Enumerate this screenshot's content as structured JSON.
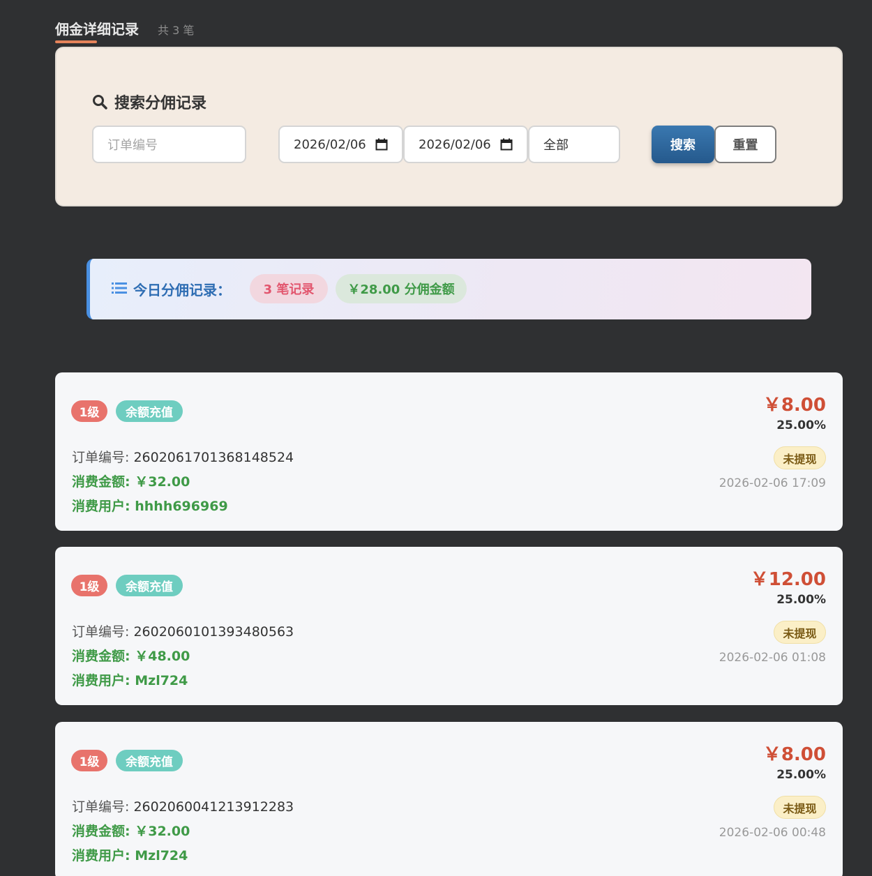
{
  "header": {
    "title": "佣金详细记录",
    "count": "共 3 笔",
    "accent": "#e5835a"
  },
  "search": {
    "heading": "搜索分佣记录",
    "order_placeholder": "订单编号",
    "start_date": "2026/02/06",
    "end_date": "2026/02/06",
    "type_select": "全部",
    "search_label": "搜索",
    "reset_label": "重置"
  },
  "summary": {
    "label": "今日分佣记录：",
    "count_text": "3 笔记录",
    "amount_text": "￥28.00 分佣金额"
  },
  "records": [
    {
      "level": "1级",
      "type": "余额充值",
      "order_label": "订单编号:",
      "order_no": "2602061701368148524",
      "amount_label": "消费金额:",
      "amount": "￥32.00",
      "user_label": "消费用户:",
      "user": "hhhh696969",
      "commission": "￥8.00",
      "rate": "25.00%",
      "status": "未提现",
      "time": "2026-02-06 17:09"
    },
    {
      "level": "1级",
      "type": "余额充值",
      "order_label": "订单编号:",
      "order_no": "2602060101393480563",
      "amount_label": "消费金额:",
      "amount": "￥48.00",
      "user_label": "消费用户:",
      "user": "Mzl724",
      "commission": "￥12.00",
      "rate": "25.00%",
      "status": "未提现",
      "time": "2026-02-06 01:08"
    },
    {
      "level": "1级",
      "type": "余额充值",
      "order_label": "订单编号:",
      "order_no": "2602060041213912283",
      "amount_label": "消费金额:",
      "amount": "￥32.00",
      "user_label": "消费用户:",
      "user": "Mzl724",
      "commission": "￥8.00",
      "rate": "25.00%",
      "status": "未提现",
      "time": "2026-02-06 00:48"
    }
  ]
}
